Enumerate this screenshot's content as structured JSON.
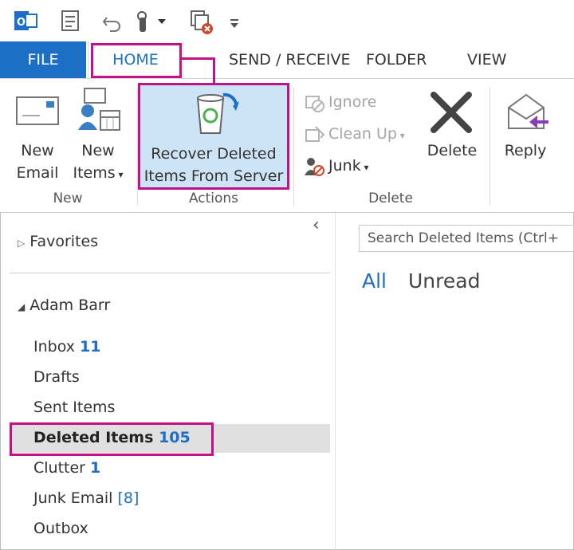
{
  "colors": {
    "accent": "#1c6fc4",
    "highlight": "#c3118a",
    "selected_row": "#e0e0e0"
  },
  "qat": {
    "icons": [
      "outlook-app-icon",
      "send-receive-all-icon",
      "undo-icon",
      "touch-mode-icon",
      "delete-all-icon",
      "customize-qat-icon"
    ]
  },
  "tabs": {
    "file": "FILE",
    "home": "HOME",
    "send_receive": "SEND / RECEIVE",
    "folder": "FOLDER",
    "view": "VIEW"
  },
  "ribbon": {
    "new_group": {
      "new_email_line1": "New",
      "new_email_line2": "Email",
      "new_items_line1": "New",
      "new_items_line2": "Items",
      "label": "New"
    },
    "actions_group": {
      "recover_line1": "Recover Deleted",
      "recover_line2": "Items From Server",
      "label": "Actions"
    },
    "delete_group": {
      "ignore": "Ignore",
      "clean_up": "Clean Up",
      "junk": "Junk",
      "delete": "Delete",
      "label": "Delete"
    },
    "respond_group": {
      "reply": "Reply"
    }
  },
  "nav": {
    "collapse_glyph": "‹",
    "favorites": "Favorites",
    "account": "Adam Barr",
    "folders": {
      "inbox": {
        "name": "Inbox",
        "count": "11"
      },
      "drafts": {
        "name": "Drafts"
      },
      "sent": {
        "name": "Sent Items"
      },
      "deleted": {
        "name": "Deleted Items",
        "count": "105"
      },
      "clutter": {
        "name": "Clutter",
        "count": "1"
      },
      "junk": {
        "name": "Junk Email",
        "count": "[8]"
      },
      "outbox": {
        "name": "Outbox"
      }
    }
  },
  "search": {
    "placeholder": "Search Deleted Items (Ctrl+"
  },
  "filters": {
    "all": "All",
    "unread": "Unread"
  }
}
